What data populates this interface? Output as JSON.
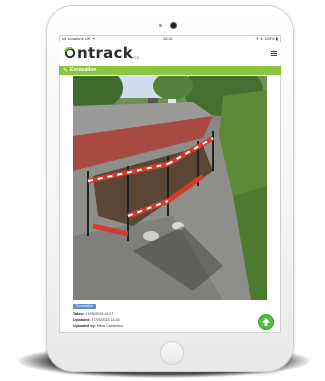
{
  "status_bar": {
    "carrier": "•ıll vodafone UK ᯤ",
    "time": "08:31",
    "battery": "✈ ∗ 100% ▮"
  },
  "app": {
    "logo_text": "ntrack",
    "logo_sub": "LITE"
  },
  "record": {
    "title": "Excavation",
    "tag": "Excavation",
    "taken_label": "Taken:",
    "taken_value": "17/05/2018 14:27",
    "uploaded_label": "Uploaded:",
    "uploaded_value": "17/05/2018 14:28",
    "uploaded_by_label": "Uploaded by:",
    "uploaded_by_value": "Milos Cancevich"
  },
  "colors": {
    "brand_green": "#8cc63f",
    "upload_green": "#58b947",
    "tag_blue": "#5b8fd0"
  },
  "icons": {
    "logo": "ontrack-logo-icon",
    "menu": "hamburger-menu-icon",
    "title": "check-icon",
    "upload": "arrow-up-icon"
  }
}
